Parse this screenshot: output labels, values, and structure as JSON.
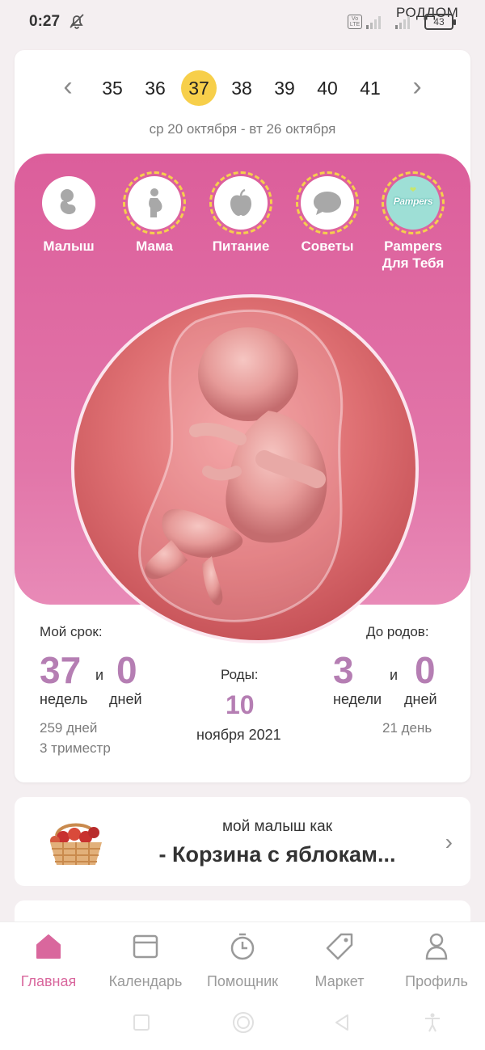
{
  "status": {
    "time": "0:27",
    "carrier": "РОДДОМ",
    "volte": "Vo LTE",
    "battery": "43"
  },
  "weeks": {
    "items": [
      "35",
      "36",
      "37",
      "38",
      "39",
      "40",
      "41"
    ],
    "active": "37",
    "date_range": "ср 20 октября - вт 26 октября"
  },
  "categories": [
    {
      "label": "Малыш",
      "icon": "baby-icon"
    },
    {
      "label": "Мама",
      "icon": "pregnant-woman-icon"
    },
    {
      "label": "Питание",
      "icon": "apple-icon"
    },
    {
      "label": "Советы",
      "icon": "chat-bubble-icon"
    },
    {
      "label": "Pampers\nДля Тебя",
      "icon": "pampers-logo",
      "logo_text": "Pampers"
    }
  ],
  "term": {
    "label": "Мой срок:",
    "weeks": "37",
    "and": "и",
    "days": "0",
    "weeks_unit": "недель",
    "days_unit": "дней",
    "total_days": "259 дней",
    "trimester": "3 триместр"
  },
  "birth": {
    "label": "Роды:",
    "day": "10",
    "month_year": "ноября 2021"
  },
  "until": {
    "label": "До родов:",
    "weeks": "3",
    "and": "и",
    "days": "0",
    "weeks_unit": "недели",
    "days_unit": "дней",
    "total_days": "21 день"
  },
  "size": {
    "subtitle": "мой малыш как",
    "title": "- Корзина с яблокам..."
  },
  "nav": [
    {
      "label": "Главная",
      "icon": "home-icon",
      "active": true
    },
    {
      "label": "Календарь",
      "icon": "calendar-icon",
      "active": false
    },
    {
      "label": "Помощник",
      "icon": "timer-icon",
      "active": false
    },
    {
      "label": "Маркет",
      "icon": "tag-icon",
      "active": false
    },
    {
      "label": "Профиль",
      "icon": "profile-icon",
      "active": false
    }
  ],
  "colors": {
    "accent_pink": "#d9679d",
    "active_week": "#f7cf4a",
    "number_purple": "#b57eb3"
  }
}
